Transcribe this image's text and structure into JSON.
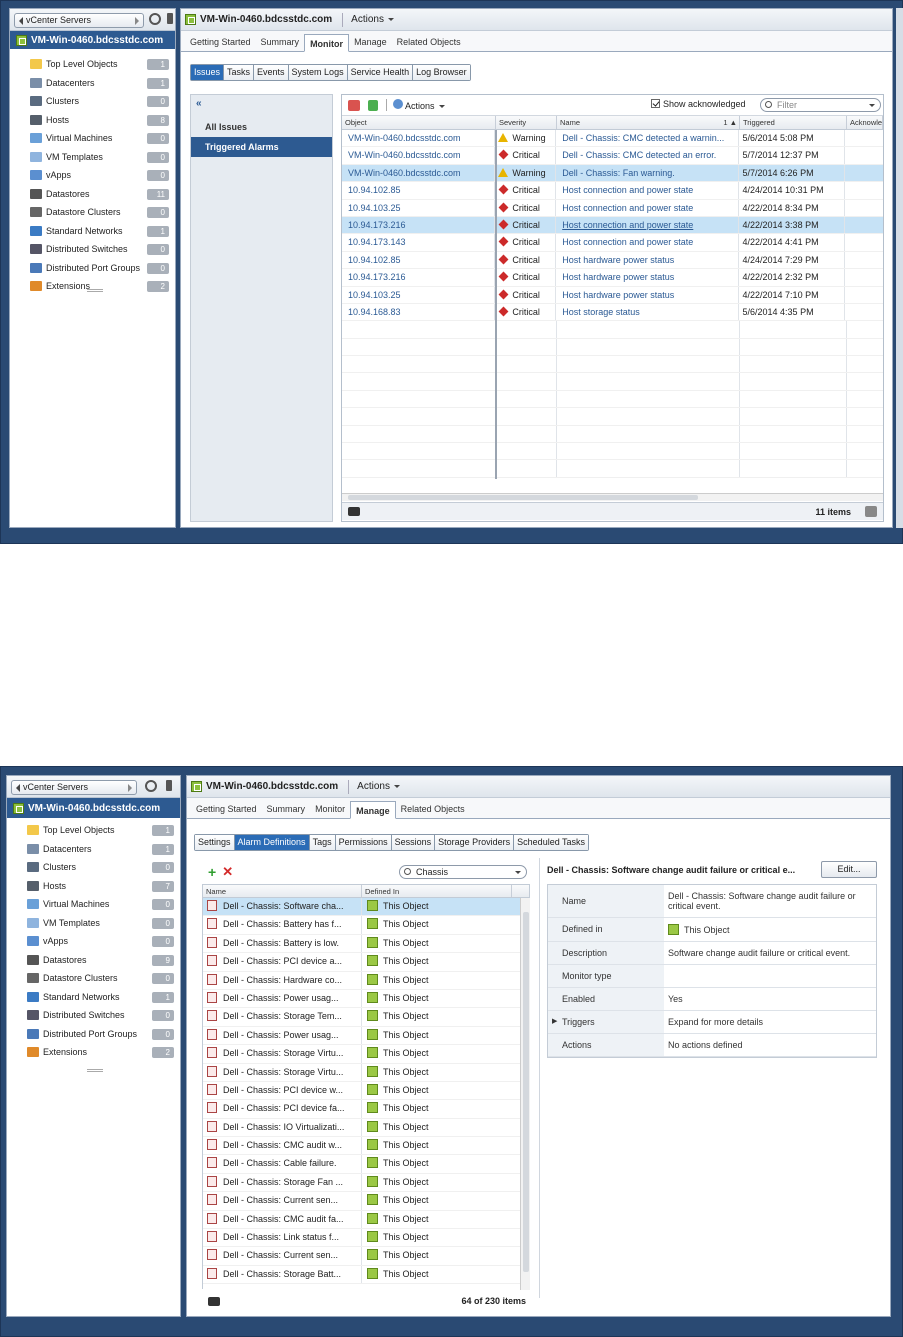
{
  "top": {
    "nav": {
      "back_label": "vCenter Servers",
      "selected": "VM-Win-0460.bdcsstdc.com",
      "items": [
        {
          "label": "Top Level Objects",
          "count": "1",
          "icon": "folder-icon",
          "color": "#f3c84a"
        },
        {
          "label": "Datacenters",
          "count": "1",
          "icon": "datacenter-icon",
          "color": "#7a8ea8"
        },
        {
          "label": "Clusters",
          "count": "0",
          "icon": "cluster-icon",
          "color": "#5a6b80"
        },
        {
          "label": "Hosts",
          "count": "8",
          "icon": "host-icon",
          "color": "#555f6b"
        },
        {
          "label": "Virtual Machines",
          "count": "0",
          "icon": "vm-icon",
          "color": "#6aa0d8"
        },
        {
          "label": "VM Templates",
          "count": "0",
          "icon": "template-icon",
          "color": "#8fb4de"
        },
        {
          "label": "vApps",
          "count": "0",
          "icon": "vapp-icon",
          "color": "#5b8fd0"
        },
        {
          "label": "Datastores",
          "count": "11",
          "icon": "datastore-icon",
          "color": "#555"
        },
        {
          "label": "Datastore Clusters",
          "count": "0",
          "icon": "datastore-cluster-icon",
          "color": "#666"
        },
        {
          "label": "Standard Networks",
          "count": "1",
          "icon": "network-icon",
          "color": "#3b7bc4"
        },
        {
          "label": "Distributed Switches",
          "count": "0",
          "icon": "dswitch-icon",
          "color": "#556"
        },
        {
          "label": "Distributed Port Groups",
          "count": "0",
          "icon": "portgroup-icon",
          "color": "#4a79b8"
        },
        {
          "label": "Extensions",
          "count": "2",
          "icon": "extension-icon",
          "color": "#e08a2a"
        }
      ]
    },
    "title": "VM-Win-0460.bdcsstdc.com",
    "actions": "Actions",
    "tabs": [
      "Getting Started",
      "Summary",
      "Monitor",
      "Manage",
      "Related Objects"
    ],
    "subtabs": [
      "Issues",
      "Tasks",
      "Events",
      "System Logs",
      "Service Health",
      "Log Browser"
    ],
    "left": [
      "All Issues",
      "Triggered Alarms"
    ],
    "toolbar": {
      "actions": "Actions",
      "show_ack": "Show acknowledged",
      "filter_placeholder": "Filter"
    },
    "columns": [
      "Object",
      "Severity",
      "Name",
      "1 ▲",
      "Triggered",
      "Acknowle"
    ],
    "rows": [
      {
        "object": "VM-Win-0460.bdcsstdc.com",
        "severity": "Warning",
        "name": "Dell - Chassis: CMC detected a warnin...",
        "triggered": "5/6/2014 5:08 PM"
      },
      {
        "object": "VM-Win-0460.bdcsstdc.com",
        "severity": "Critical",
        "name": "Dell - Chassis: CMC detected an error.",
        "triggered": "5/7/2014 12:37 PM"
      },
      {
        "object": "VM-Win-0460.bdcsstdc.com",
        "severity": "Warning",
        "name": "Dell - Chassis: Fan warning.",
        "triggered": "5/7/2014 6:26 PM",
        "selected": true
      },
      {
        "object": "10.94.102.85",
        "severity": "Critical",
        "name": "Host connection and power state",
        "triggered": "4/24/2014 10:31 PM"
      },
      {
        "object": "10.94.103.25",
        "severity": "Critical",
        "name": "Host connection and power state",
        "triggered": "4/22/2014 8:34 PM"
      },
      {
        "object": "10.94.173.216",
        "severity": "Critical",
        "name": "Host connection and power state",
        "triggered": "4/22/2014 3:38 PM",
        "selected": true
      },
      {
        "object": "10.94.173.143",
        "severity": "Critical",
        "name": "Host connection and power state",
        "triggered": "4/22/2014 4:41 PM"
      },
      {
        "object": "10.94.102.85",
        "severity": "Critical",
        "name": "Host hardware power status",
        "triggered": "4/24/2014 7:29 PM"
      },
      {
        "object": "10.94.173.216",
        "severity": "Critical",
        "name": "Host hardware power status",
        "triggered": "4/22/2014 2:32 PM"
      },
      {
        "object": "10.94.103.25",
        "severity": "Critical",
        "name": "Host hardware power status",
        "triggered": "4/22/2014 7:10 PM"
      },
      {
        "object": "10.94.168.83",
        "severity": "Critical",
        "name": "Host storage status",
        "triggered": "5/6/2014 4:35 PM"
      }
    ],
    "footer": "11 items"
  },
  "bottom": {
    "nav": {
      "back_label": "vCenter Servers",
      "selected": "VM-Win-0460.bdcsstdc.com",
      "items": [
        {
          "label": "Top Level Objects",
          "count": "1",
          "icon": "folder-icon",
          "color": "#f3c84a"
        },
        {
          "label": "Datacenters",
          "count": "1",
          "icon": "datacenter-icon",
          "color": "#7a8ea8"
        },
        {
          "label": "Clusters",
          "count": "0",
          "icon": "cluster-icon",
          "color": "#5a6b80"
        },
        {
          "label": "Hosts",
          "count": "7",
          "icon": "host-icon",
          "color": "#555f6b"
        },
        {
          "label": "Virtual Machines",
          "count": "0",
          "icon": "vm-icon",
          "color": "#6aa0d8"
        },
        {
          "label": "VM Templates",
          "count": "0",
          "icon": "template-icon",
          "color": "#8fb4de"
        },
        {
          "label": "vApps",
          "count": "0",
          "icon": "vapp-icon",
          "color": "#5b8fd0"
        },
        {
          "label": "Datastores",
          "count": "9",
          "icon": "datastore-icon",
          "color": "#555"
        },
        {
          "label": "Datastore Clusters",
          "count": "0",
          "icon": "datastore-cluster-icon",
          "color": "#666"
        },
        {
          "label": "Standard Networks",
          "count": "1",
          "icon": "network-icon",
          "color": "#3b7bc4"
        },
        {
          "label": "Distributed Switches",
          "count": "0",
          "icon": "dswitch-icon",
          "color": "#556"
        },
        {
          "label": "Distributed Port Groups",
          "count": "0",
          "icon": "portgroup-icon",
          "color": "#4a79b8"
        },
        {
          "label": "Extensions",
          "count": "2",
          "icon": "extension-icon",
          "color": "#e08a2a"
        }
      ]
    },
    "title": "VM-Win-0460.bdcsstdc.com",
    "actions": "Actions",
    "tabs": [
      "Getting Started",
      "Summary",
      "Monitor",
      "Manage",
      "Related Objects"
    ],
    "subtabs": [
      "Settings",
      "Alarm Definitions",
      "Tags",
      "Permissions",
      "Sessions",
      "Storage Providers",
      "Scheduled Tasks"
    ],
    "search_value": "Chassis",
    "columns": [
      "Name",
      "Defined In"
    ],
    "rows": [
      "Dell - Chassis: Software cha...",
      "Dell - Chassis: Battery has f...",
      "Dell - Chassis: Battery is low.",
      "Dell - Chassis: PCI device a...",
      "Dell - Chassis: Hardware co...",
      "Dell - Chassis: Power usag...",
      "Dell - Chassis: Storage Tem...",
      "Dell - Chassis: Power usag...",
      "Dell - Chassis: Storage Virtu...",
      "Dell - Chassis: Storage Virtu...",
      "Dell - Chassis: PCI device w...",
      "Dell - Chassis: PCI device fa...",
      "Dell - Chassis: IO Virtualizati...",
      "Dell - Chassis: CMC audit w...",
      "Dell - Chassis: Cable failure.",
      "Dell - Chassis: Storage Fan ...",
      "Dell - Chassis: Current sen...",
      "Dell - Chassis: CMC audit fa...",
      "Dell - Chassis: Link status f...",
      "Dell - Chassis: Current sen...",
      "Dell - Chassis: Storage Batt..."
    ],
    "defined_in": "This Object",
    "footer": "64 of 230 items",
    "detail": {
      "title": "Dell - Chassis: Software change audit failure or critical e...",
      "edit": "Edit...",
      "rows": [
        {
          "k": "Name",
          "v": "Dell - Chassis: Software change audit failure or critical event."
        },
        {
          "k": "Defined in",
          "v": "This Object"
        },
        {
          "k": "Description",
          "v": "Software change audit failure or critical event."
        },
        {
          "k": "Monitor type",
          "v": ""
        },
        {
          "k": "Enabled",
          "v": "Yes"
        },
        {
          "k": "Triggers",
          "v": "Expand for more details"
        },
        {
          "k": "Actions",
          "v": "No actions defined"
        }
      ]
    }
  }
}
